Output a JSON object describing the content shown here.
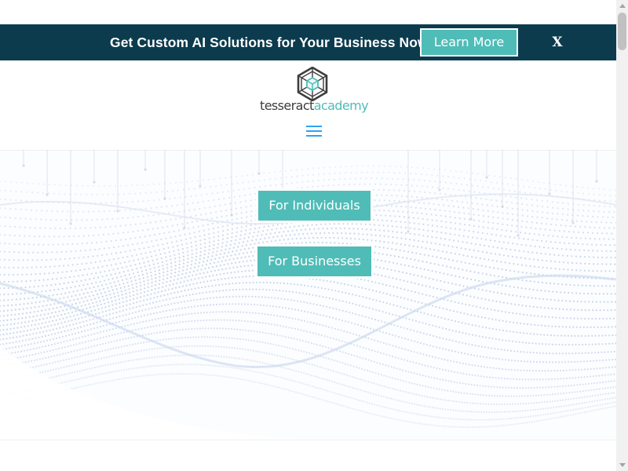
{
  "promo": {
    "text": "Get Custom AI Solutions for Your Business Now",
    "button_label": "Learn More",
    "close_label": "X",
    "background": "#0c3b4e",
    "button_color": "#4fbcb7"
  },
  "header": {
    "logo_icon": "tesseract-cube-icon",
    "logo_text_1": "tesseract",
    "logo_text_2": "academy",
    "menu_icon": "hamburger-menu-icon"
  },
  "hero": {
    "buttons": [
      {
        "label": "For Individuals"
      },
      {
        "label": "For Businesses"
      }
    ]
  },
  "colors": {
    "accent": "#4fbcb7",
    "menu": "#2ea3f2"
  }
}
